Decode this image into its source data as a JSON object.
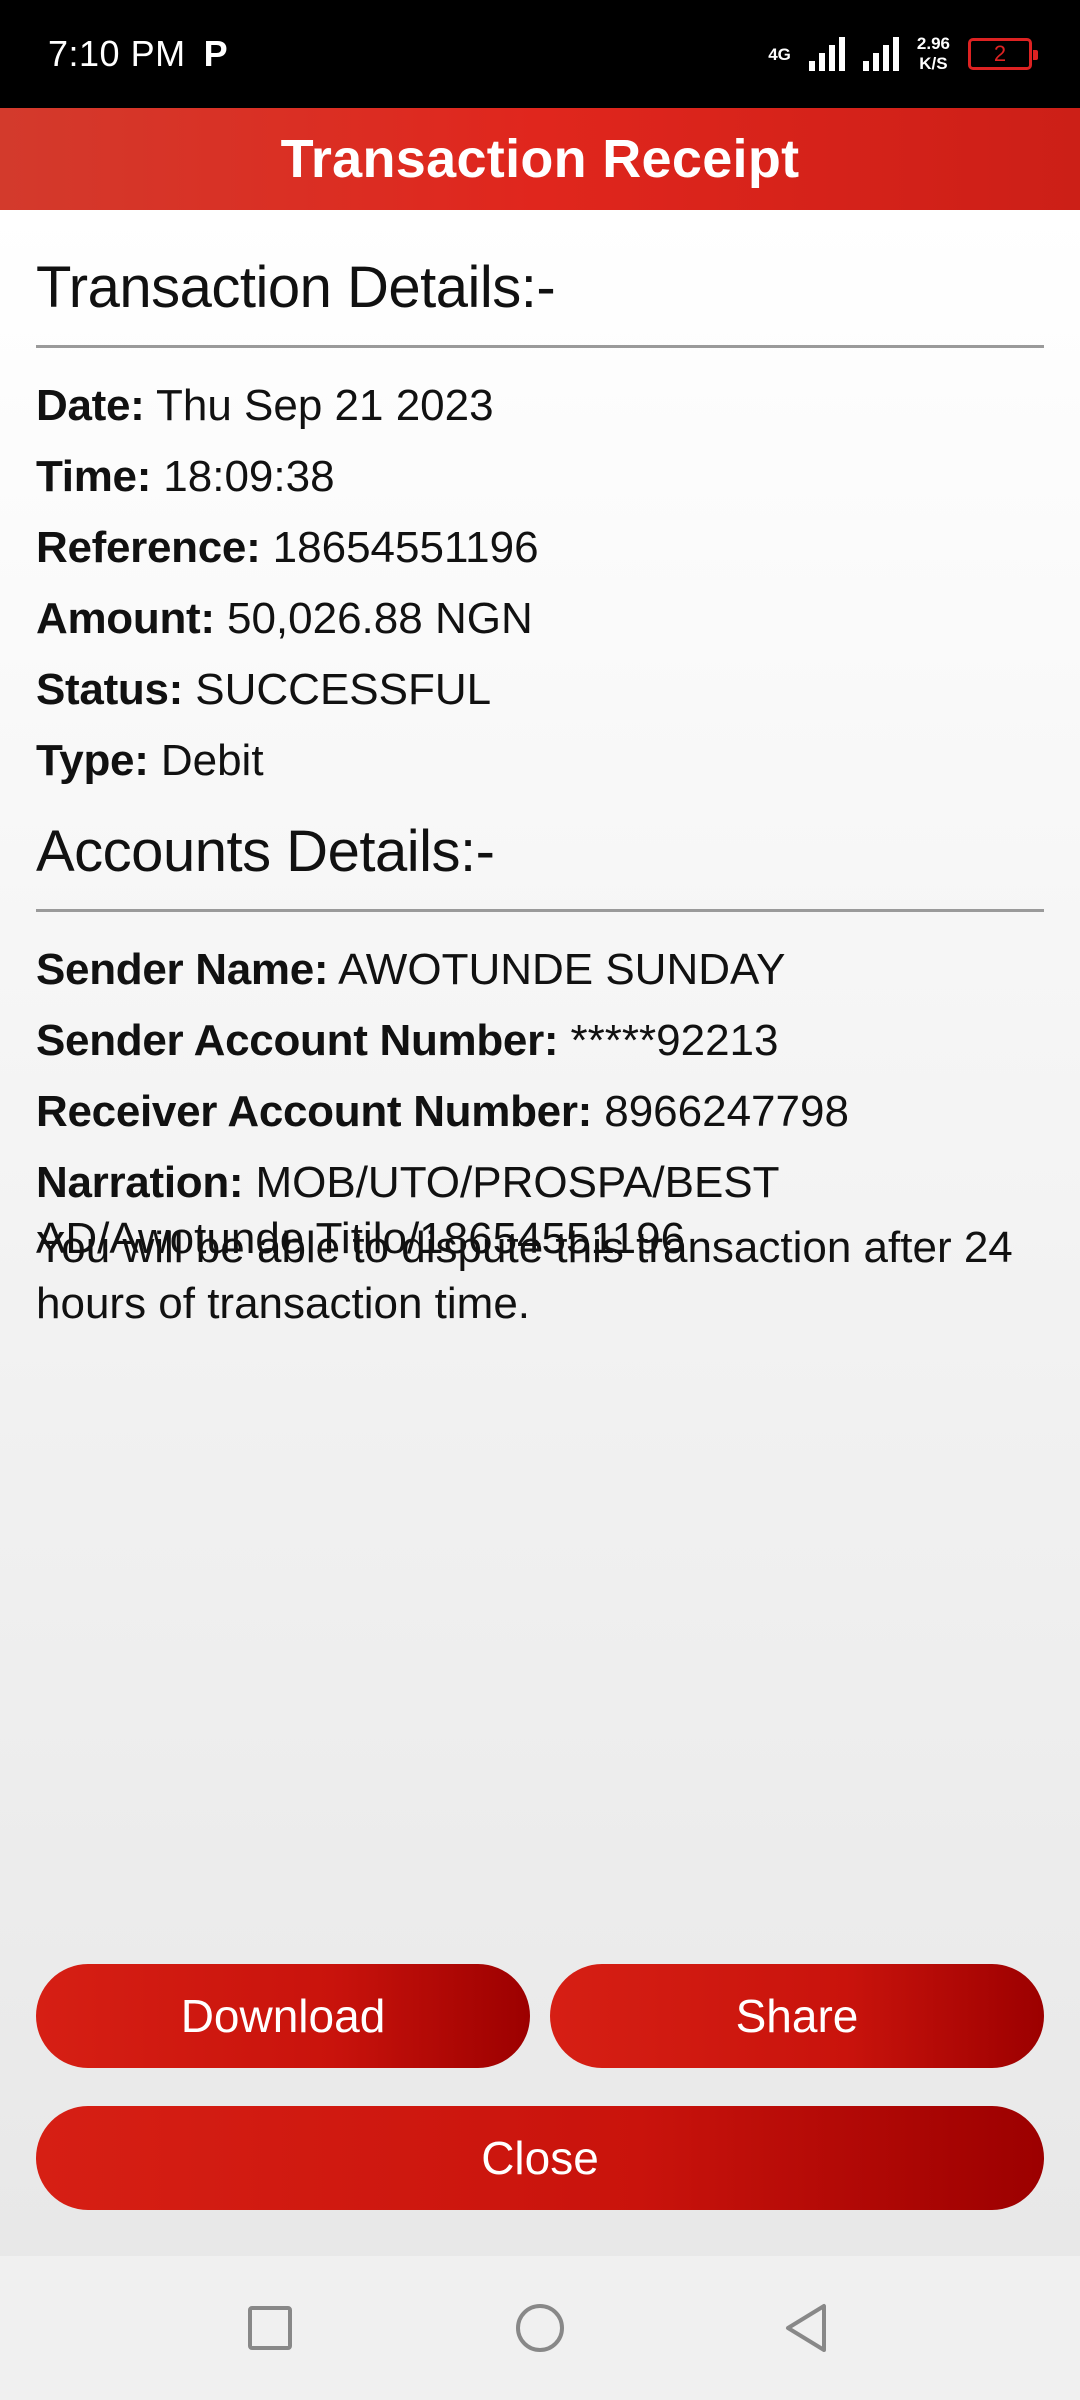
{
  "status_bar": {
    "time": "7:10 PM",
    "p_icon": "P",
    "network": "4G",
    "speed_value": "2.96",
    "speed_unit": "K/S",
    "battery": "2"
  },
  "header": {
    "title": "Transaction Receipt"
  },
  "transaction": {
    "title": "Transaction Details:-",
    "rows": [
      {
        "label": "Date:",
        "value": "Thu Sep 21 2023"
      },
      {
        "label": "Time:",
        "value": "18:09:38"
      },
      {
        "label": "Reference:",
        "value": "18654551196"
      },
      {
        "label": "Amount:",
        "value": "50,026.88 NGN"
      },
      {
        "label": "Status:",
        "value": "SUCCESSFUL"
      },
      {
        "label": "Type:",
        "value": "Debit"
      }
    ]
  },
  "accounts": {
    "title": "Accounts Details:-",
    "rows": [
      {
        "label": "Sender Name:",
        "value": "AWOTUNDE SUNDAY"
      },
      {
        "label": "Sender Account Number:",
        "value": "*****92213"
      },
      {
        "label": "Receiver Account Number:",
        "value": "8966247798"
      },
      {
        "label": "Narration:",
        "value": "MOB/UTO/PROSPA/BEST AD/Awotunde Titilo/18654551196"
      }
    ]
  },
  "dispute_note": "You will be able to dispute this transaction after 24 hours of transaction time.",
  "buttons": {
    "download": "Download",
    "share": "Share",
    "close": "Close"
  },
  "nav": {
    "recents_icon": "square-icon",
    "home_icon": "circle-icon",
    "back_icon": "triangle-back-icon"
  },
  "colors": {
    "accent": "#d61f14",
    "header_bg": "#e0261d"
  }
}
